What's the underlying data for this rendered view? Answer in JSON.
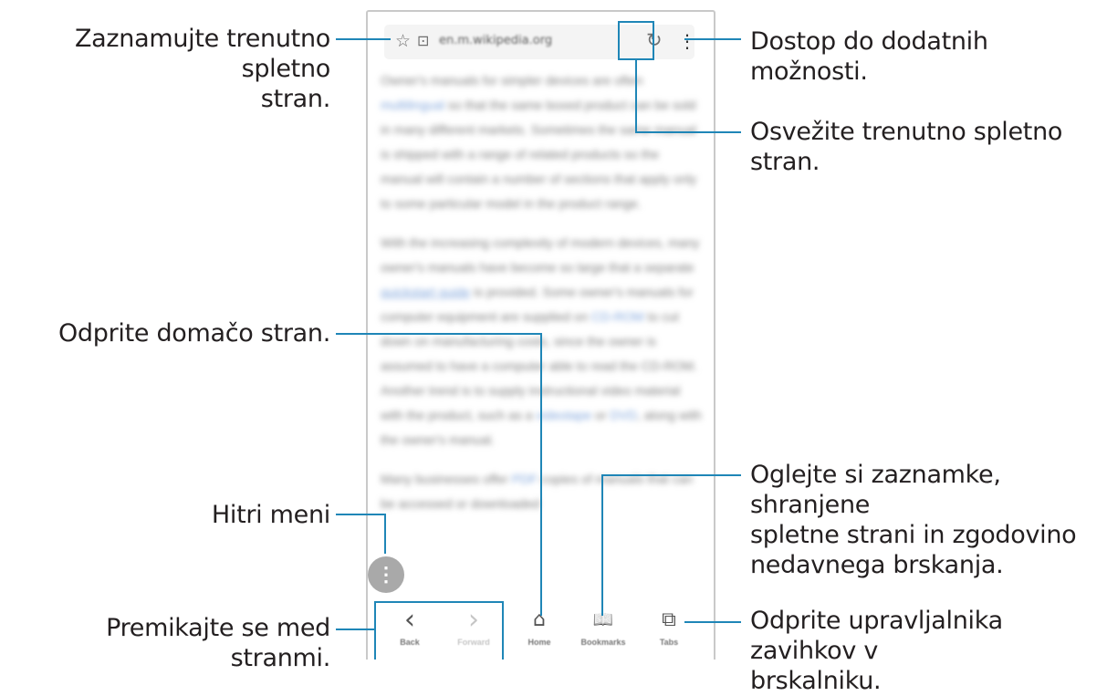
{
  "callouts": {
    "bookmark_page": [
      "Zaznamujte trenutno spletno",
      "stran."
    ],
    "more_options": "Dostop do dodatnih možnosti.",
    "refresh": "Osvežite trenutno spletno stran.",
    "home": "Odprite domačo stran.",
    "bookmarks": [
      "Oglejte si zaznamke, shranjene",
      "spletne strani in zgodovino",
      "nedavnega brskanja."
    ],
    "quick_menu": "Hitri meni",
    "navigate": "Premikajte se med stranmi.",
    "tabs": [
      "Odprite upravljalnika zavihkov v",
      "brskalniku."
    ]
  },
  "browser": {
    "url": "en.m.wikipedia.org",
    "paragraphs": [
      [
        "Owner's manuals for simpler devices are often ",
        {
          "link": "multilingual"
        },
        " so that the same boxed product can be sold in many different markets. Sometimes the same manual is shipped with a range of related products so the manual will contain a number of sections that apply only to some particular model in the product range."
      ],
      [
        "With the increasing complexity of modern devices, many owner's manuals have become so large that a separate ",
        {
          "link_u": "quickstart guide"
        },
        " is provided. Some owner's manuals for computer equipment are supplied on ",
        {
          "link": "CD-ROM"
        },
        " to cut down on manufacturing costs, since the owner is assumed to have a computer able to read the CD-ROM. Another trend is to supply instructional video material with the product, such as a ",
        {
          "link": "videotape"
        },
        " or ",
        {
          "link": "DVD"
        },
        ", along with the owner's manual."
      ],
      [
        "Many businesses offer ",
        {
          "link": "PDF"
        },
        " copies of manuals that can be accessed or downloaded"
      ]
    ],
    "nav": {
      "back": "Back",
      "forward": "Forward",
      "home": "Home",
      "bookmarks": "Bookmarks",
      "tabs": "Tabs"
    },
    "icons": {
      "star": "☆",
      "lock": "⊡",
      "refresh": "↻",
      "more": "⋮",
      "back": "‹",
      "forward": "›",
      "home": "⌂",
      "bookmarks": "📖",
      "tabs": "⧉"
    }
  },
  "colors": {
    "accent": "#1f86b7",
    "link": "#7da3db"
  }
}
